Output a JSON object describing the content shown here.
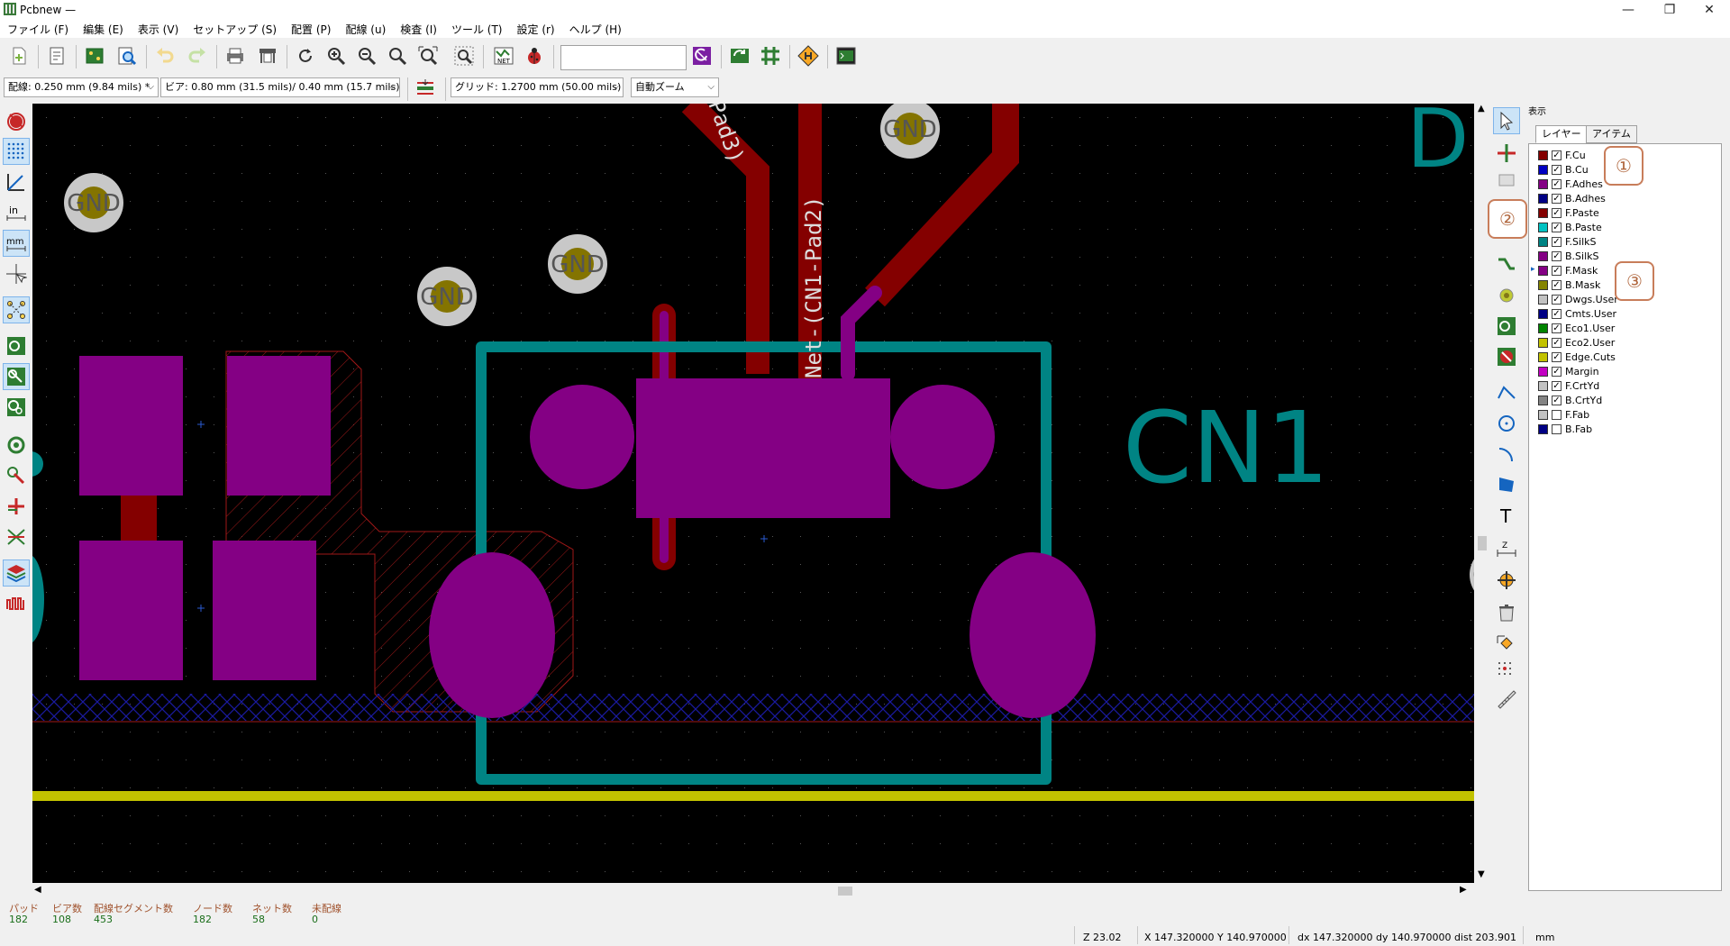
{
  "window": {
    "title": "Pcbnew —",
    "controls": [
      "—",
      "❐",
      "✕"
    ]
  },
  "menu": [
    "ファイル (F)",
    "編集 (E)",
    "表示 (V)",
    "セットアップ (S)",
    "配置 (P)",
    "配線 (u)",
    "検査 (I)",
    "ツール (T)",
    "設定 (r)",
    "ヘルプ (H)"
  ],
  "toolbar2": {
    "track": "配線: 0.250 mm (9.84 mils) *",
    "via": "ビア: 0.80 mm (31.5 mils)/ 0.40 mm (15.7 mils) *",
    "grid": "グリッド: 1.2700 mm (50.00 mils)",
    "zoom": "自動ズーム"
  },
  "canvas": {
    "gnd_label": "GND",
    "ref_label": "CN1",
    "net_label_1": "Net-(CN1-Pad2)",
    "net_label_2": "Pad3)",
    "corner_label": "D"
  },
  "panel": {
    "header": "表示",
    "tabs": [
      "レイヤー",
      "アイテム"
    ],
    "layers": [
      {
        "name": "F.Cu",
        "color": "#840000",
        "checked": true
      },
      {
        "name": "B.Cu",
        "color": "#0000c2",
        "checked": true
      },
      {
        "name": "F.Adhes",
        "color": "#840084",
        "checked": true
      },
      {
        "name": "B.Adhes",
        "color": "#000084",
        "checked": true
      },
      {
        "name": "F.Paste",
        "color": "#840000",
        "checked": true
      },
      {
        "name": "B.Paste",
        "color": "#00c2c2",
        "checked": true
      },
      {
        "name": "F.SilkS",
        "color": "#008484",
        "checked": true
      },
      {
        "name": "B.SilkS",
        "color": "#840084",
        "checked": true
      },
      {
        "name": "F.Mask",
        "color": "#840084",
        "checked": true
      },
      {
        "name": "B.Mask",
        "color": "#848400",
        "checked": true
      },
      {
        "name": "Dwgs.User",
        "color": "#c2c2c2",
        "checked": true
      },
      {
        "name": "Cmts.User",
        "color": "#000084",
        "checked": true
      },
      {
        "name": "Eco1.User",
        "color": "#008400",
        "checked": true
      },
      {
        "name": "Eco2.User",
        "color": "#c2c200",
        "checked": true
      },
      {
        "name": "Edge.Cuts",
        "color": "#c2c200",
        "checked": true
      },
      {
        "name": "Margin",
        "color": "#c200c2",
        "checked": true
      },
      {
        "name": "F.CrtYd",
        "color": "#c2c2c2",
        "checked": true
      },
      {
        "name": "B.CrtYd",
        "color": "#848484",
        "checked": true
      },
      {
        "name": "F.Fab",
        "color": "#c2c2c2",
        "checked": false
      },
      {
        "name": "B.Fab",
        "color": "#000084",
        "checked": false
      }
    ]
  },
  "callouts": [
    "①",
    "②",
    "③"
  ],
  "status": {
    "pads_label": "パッド",
    "pads": "182",
    "vias_label": "ビア数",
    "vias": "108",
    "segs_label": "配線セグメント数",
    "segs": "453",
    "nodes_label": "ノード数",
    "nodes": "182",
    "nets_label": "ネット数",
    "nets": "58",
    "unrouted_label": "未配線",
    "unrouted": "0",
    "zoom": "Z 23.02",
    "xy": "X 147.320000  Y 140.970000",
    "dxy": "dx 147.320000  dy 140.970000  dist 203.901",
    "units": "mm"
  },
  "colors": {
    "copper": "#840000",
    "mask": "#840084",
    "silk": "#008484",
    "edge": "#c2c200",
    "pad_ring": "#c8c8c8"
  }
}
